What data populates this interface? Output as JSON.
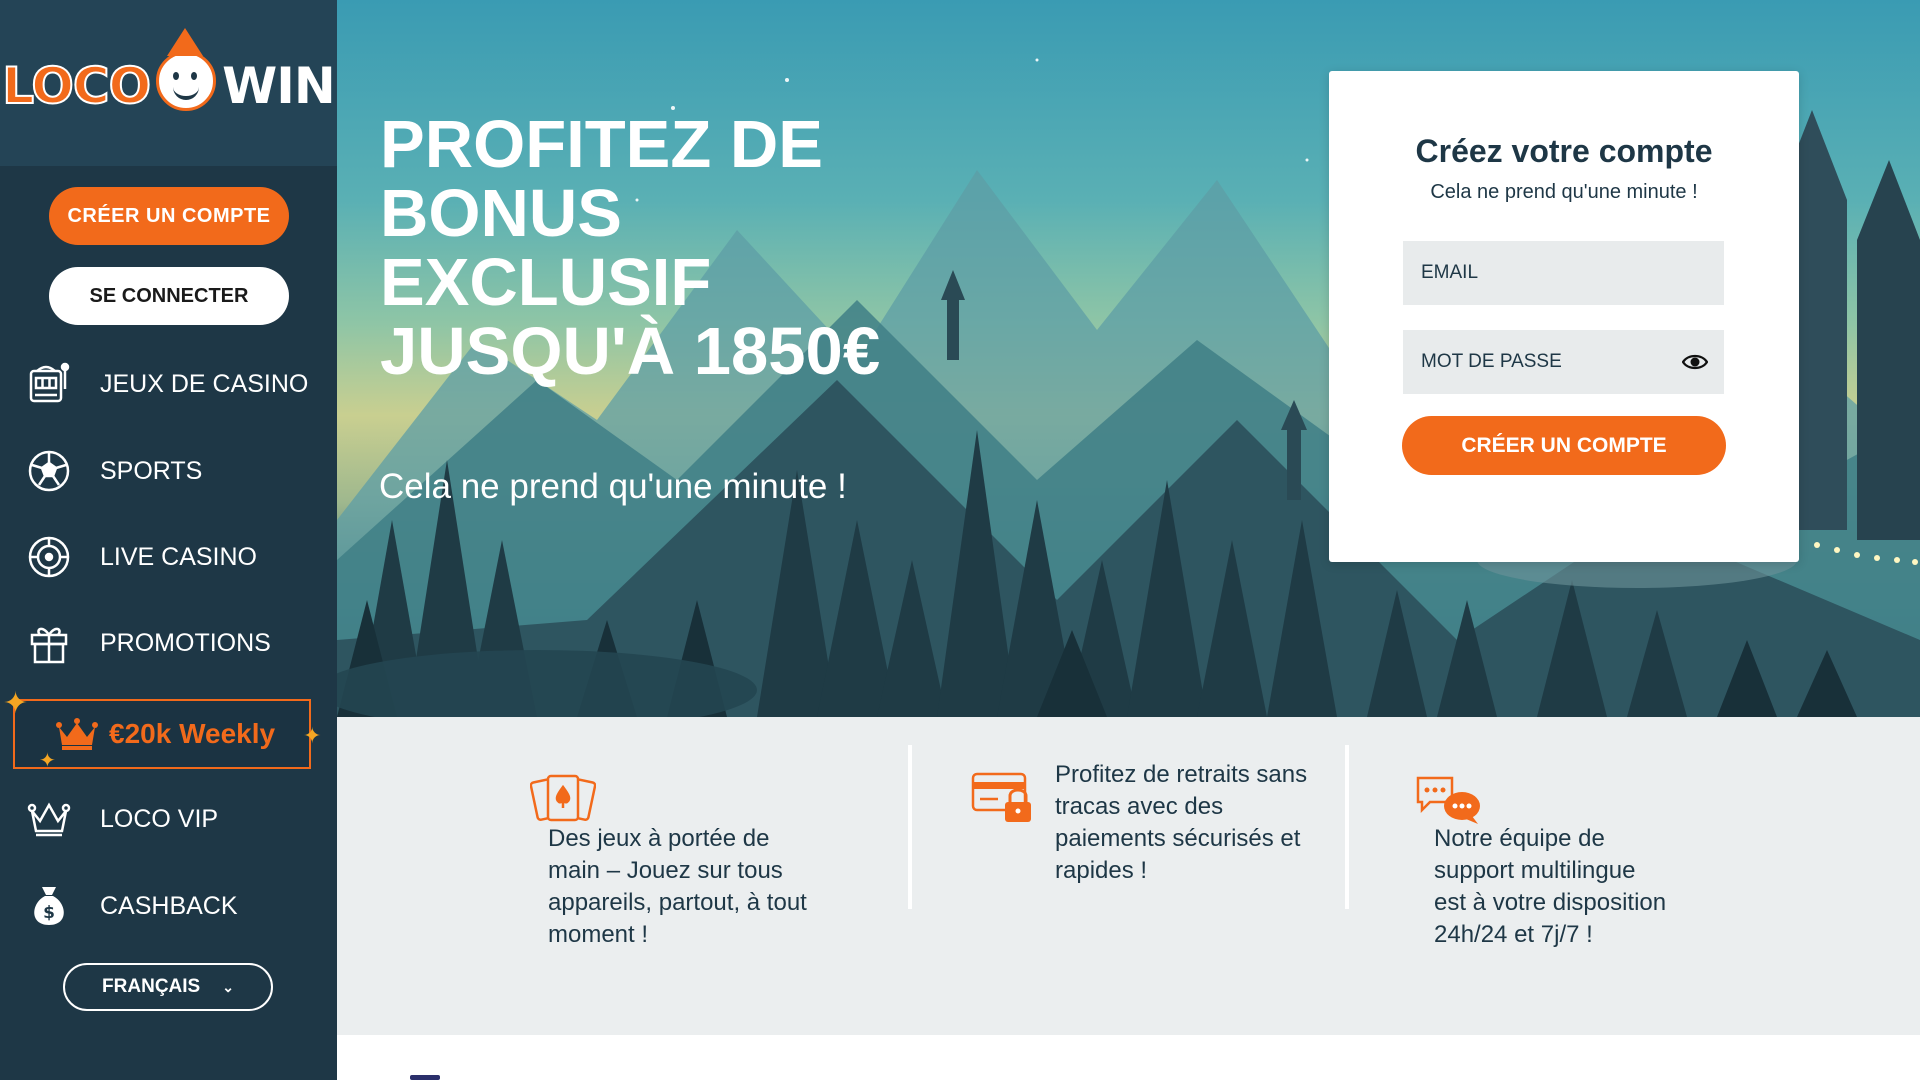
{
  "brand": {
    "logo_left": "LOCO",
    "logo_right": "WIN"
  },
  "sidebar": {
    "create_account_label": "CRÉER UN COMPTE",
    "login_label": "SE CONNECTER",
    "items": [
      {
        "label": "JEUX DE CASINO",
        "icon": "slot-machine-icon"
      },
      {
        "label": "SPORTS",
        "icon": "soccer-ball-icon"
      },
      {
        "label": "LIVE CASINO",
        "icon": "roulette-chip-icon"
      },
      {
        "label": "PROMOTIONS",
        "icon": "gift-icon"
      },
      {
        "label": "LOCO VIP",
        "icon": "crown-vip-icon"
      },
      {
        "label": "CASHBACK",
        "icon": "money-bag-icon"
      }
    ],
    "weekly_label": "€20k Weekly",
    "language_label": "FRANÇAIS"
  },
  "hero": {
    "title": "PROFITEZ DE BONUS EXCLUSIF JUSQU'À 1850€",
    "subtitle": "Cela ne prend qu'une minute !"
  },
  "signup": {
    "title": "Créez votre compte",
    "subtitle": "Cela ne prend qu'une minute !",
    "email_placeholder": "EMAIL",
    "password_placeholder": "MOT DE PASSE",
    "submit_label": "CRÉER UN COMPTE"
  },
  "features": [
    {
      "text": "Des jeux à portée de main – Jouez sur tous appareils, partout, à tout moment !",
      "icon": "playing-cards-icon"
    },
    {
      "text": "Profitez de retraits sans tracas avec des paiements sécurisés et rapides !",
      "icon": "secure-card-icon"
    },
    {
      "text": "Notre équipe de support multilingue est à votre disposition 24h/24 et 7j/7 !",
      "icon": "chat-bubbles-icon"
    }
  ],
  "colors": {
    "accent": "#f26a1b",
    "sidebar_bg": "#1e3746",
    "text_dark": "#1e3746",
    "features_bg": "#ebeeef"
  }
}
